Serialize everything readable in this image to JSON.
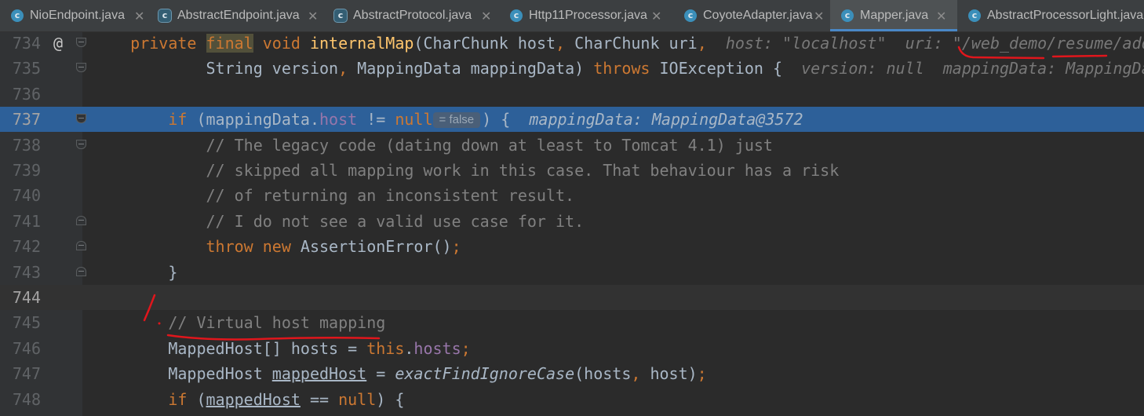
{
  "tabs": [
    {
      "name": "NioEndpoint.java",
      "icon": "c"
    },
    {
      "name": "AbstractEndpoint.java",
      "icon": "c"
    },
    {
      "name": "AbstractProtocol.java",
      "icon": "c"
    },
    {
      "name": "Http11Processor.java",
      "icon": "c"
    },
    {
      "name": "CoyoteAdapter.java",
      "icon": "c"
    },
    {
      "name": "Mapper.java",
      "icon": "c",
      "active": true
    },
    {
      "name": "AbstractProcessorLight.java",
      "icon": "c"
    }
  ],
  "gutter": {
    "override_marker": "@"
  },
  "inline_value": "= false",
  "colors": {
    "execution_line": "#2d6099",
    "annotation_red": "#e0161c",
    "tab_underline": "#4a88c7"
  },
  "lines": [
    {
      "num": "734",
      "segments": [
        {
          "t": "    "
        },
        {
          "t": "private ",
          "c": "kw"
        },
        {
          "t": "final",
          "c": "kw hl-final"
        },
        {
          "t": " void ",
          "c": "kw"
        },
        {
          "t": "internalMap",
          "c": "fn"
        },
        {
          "t": "(CharChunk host"
        },
        {
          "t": ", ",
          "c": "kw"
        },
        {
          "t": "CharChunk uri"
        },
        {
          "t": ",  ",
          "c": "kw"
        },
        {
          "t": "host: \"localhost\"  uri: \"/web_demo/resume/add",
          "c": "hint"
        }
      ]
    },
    {
      "num": "735",
      "segments": [
        {
          "t": "            String version"
        },
        {
          "t": ", ",
          "c": "kw"
        },
        {
          "t": "MappingData mappingData) "
        },
        {
          "t": "throws ",
          "c": "kw"
        },
        {
          "t": "IOException {  "
        },
        {
          "t": "version: null  mappingData: MappingDa",
          "c": "hint"
        }
      ]
    },
    {
      "num": "736",
      "segments": []
    },
    {
      "num": "737",
      "segments": [
        {
          "t": "        "
        },
        {
          "t": "if ",
          "c": "kw"
        },
        {
          "t": "(mappingData."
        },
        {
          "t": "host",
          "c": "fld"
        },
        {
          "t": " != "
        },
        {
          "t": "null",
          "c": "kw"
        },
        {
          "t": "= false",
          "c": "inline-val"
        },
        {
          "t": ") {  "
        },
        {
          "t": "mappingData: MappingData@3572",
          "c": "hint"
        }
      ]
    },
    {
      "num": "738",
      "segments": [
        {
          "t": "            // The legacy code (dating down at least to Tomcat 4.1) just",
          "c": "cm"
        }
      ]
    },
    {
      "num": "739",
      "segments": [
        {
          "t": "            // skipped all mapping work in this case. That behaviour has a risk",
          "c": "cm"
        }
      ]
    },
    {
      "num": "740",
      "segments": [
        {
          "t": "            // of returning an inconsistent result.",
          "c": "cm"
        }
      ]
    },
    {
      "num": "741",
      "segments": [
        {
          "t": "            // I do not see a valid use case for it.",
          "c": "cm"
        }
      ]
    },
    {
      "num": "742",
      "segments": [
        {
          "t": "            "
        },
        {
          "t": "throw new ",
          "c": "kw"
        },
        {
          "t": "AssertionError()"
        },
        {
          "t": ";",
          "c": "kw"
        }
      ]
    },
    {
      "num": "743",
      "segments": [
        {
          "t": "        }"
        }
      ]
    },
    {
      "num": "744",
      "segments": []
    },
    {
      "num": "745",
      "segments": [
        {
          "t": "        // Virtual host mapping",
          "c": "cm"
        }
      ]
    },
    {
      "num": "746",
      "segments": [
        {
          "t": "        MappedHost[] hosts = "
        },
        {
          "t": "this",
          "c": "kw"
        },
        {
          "t": "."
        },
        {
          "t": "hosts",
          "c": "fld"
        },
        {
          "t": ";",
          "c": "kw"
        }
      ]
    },
    {
      "num": "747",
      "segments": [
        {
          "t": "        MappedHost "
        },
        {
          "t": "mappedHost",
          "c": "und"
        },
        {
          "t": " = "
        },
        {
          "t": "exactFindIgnoreCase",
          "c": "st"
        },
        {
          "t": "(hosts"
        },
        {
          "t": ", ",
          "c": "kw"
        },
        {
          "t": "host)"
        },
        {
          "t": ";",
          "c": "kw"
        }
      ]
    },
    {
      "num": "748",
      "segments": [
        {
          "t": "        "
        },
        {
          "t": "if ",
          "c": "kw"
        },
        {
          "t": "("
        },
        {
          "t": "mappedHost",
          "c": "und"
        },
        {
          "t": " == "
        },
        {
          "t": "null",
          "c": "kw"
        },
        {
          "t": ") {"
        }
      ]
    }
  ]
}
